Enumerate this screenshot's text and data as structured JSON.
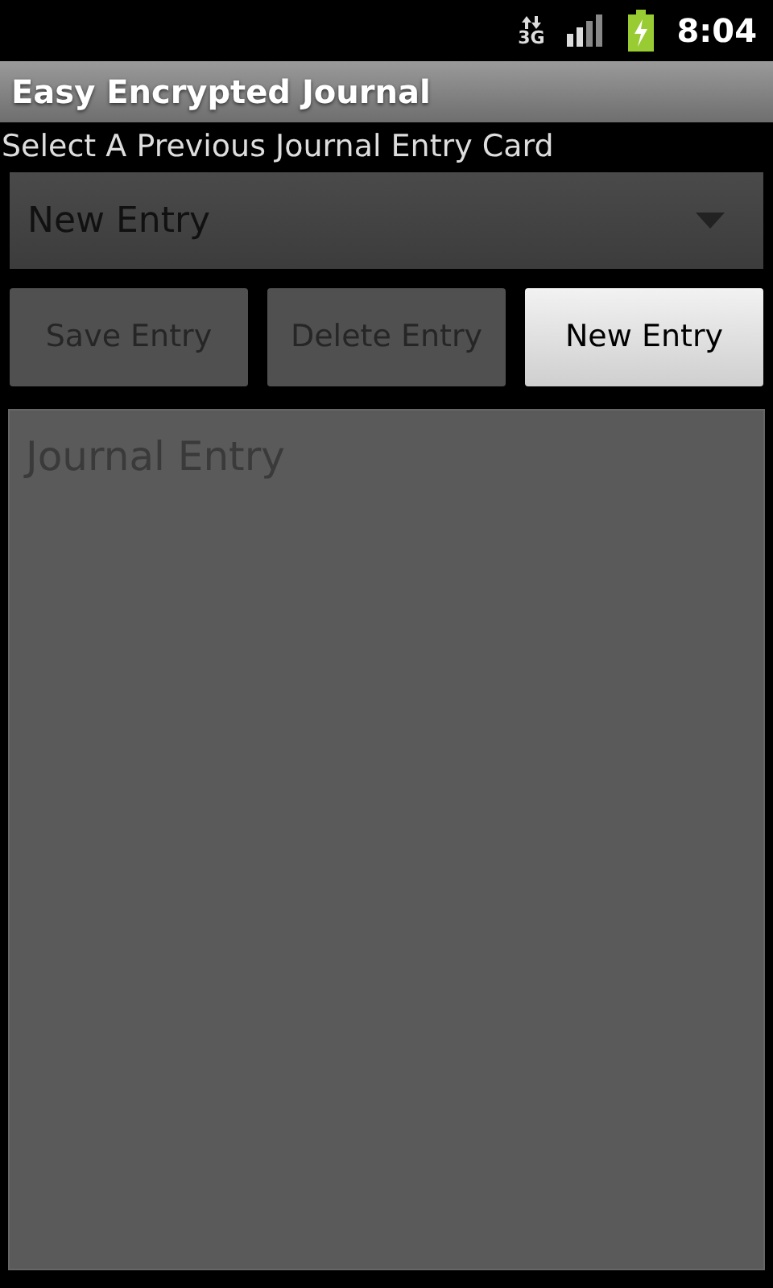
{
  "status_bar": {
    "network": "3G",
    "time": "8:04"
  },
  "window": {
    "title": "Easy Encrypted Journal"
  },
  "prompt": "Select A Previous Journal Entry Card",
  "entry_picker": {
    "value": "New Entry",
    "disabled": true
  },
  "buttons": [
    {
      "label": "Save Entry",
      "disabled": true
    },
    {
      "label": "Delete Entry",
      "disabled": true
    },
    {
      "label": "New Entry",
      "disabled": false
    }
  ],
  "journal_field": {
    "placeholder": "Journal Entry"
  }
}
